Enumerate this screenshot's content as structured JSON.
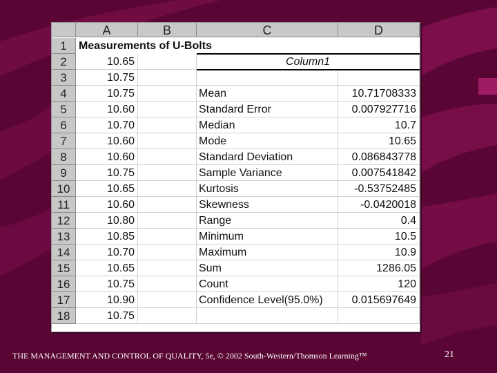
{
  "columns": [
    "A",
    "B",
    "C",
    "D"
  ],
  "title": "Measurements of U-Bolts",
  "stats_header": "Column1",
  "rows": [
    {
      "n": "1",
      "a": "",
      "c": "",
      "d": ""
    },
    {
      "n": "2",
      "a": "10.65",
      "c": "",
      "d": ""
    },
    {
      "n": "3",
      "a": "10.75",
      "c": "",
      "d": ""
    },
    {
      "n": "4",
      "a": "10.75",
      "c": "Mean",
      "d": "10.71708333"
    },
    {
      "n": "5",
      "a": "10.60",
      "c": "Standard Error",
      "d": "0.007927716"
    },
    {
      "n": "6",
      "a": "10.70",
      "c": "Median",
      "d": "10.7"
    },
    {
      "n": "7",
      "a": "10.60",
      "c": "Mode",
      "d": "10.65"
    },
    {
      "n": "8",
      "a": "10.60",
      "c": "Standard Deviation",
      "d": "0.086843778"
    },
    {
      "n": "9",
      "a": "10.75",
      "c": "Sample Variance",
      "d": "0.007541842"
    },
    {
      "n": "10",
      "a": "10.65",
      "c": "Kurtosis",
      "d": "-0.53752485"
    },
    {
      "n": "11",
      "a": "10.60",
      "c": "Skewness",
      "d": "-0.0420018"
    },
    {
      "n": "12",
      "a": "10.80",
      "c": "Range",
      "d": "0.4"
    },
    {
      "n": "13",
      "a": "10.85",
      "c": "Minimum",
      "d": "10.5"
    },
    {
      "n": "14",
      "a": "10.70",
      "c": "Maximum",
      "d": "10.9"
    },
    {
      "n": "15",
      "a": "10.65",
      "c": "Sum",
      "d": "1286.05"
    },
    {
      "n": "16",
      "a": "10.75",
      "c": "Count",
      "d": "120"
    },
    {
      "n": "17",
      "a": "10.90",
      "c": "Confidence Level(95.0%)",
      "d": "0.015697649"
    },
    {
      "n": "18",
      "a": "10.75",
      "c": "",
      "d": ""
    }
  ],
  "footer": "THE MANAGEMENT AND CONTROL OF QUALITY, 5e, © 2002 South-Western/Thomson Learning™",
  "page_number": "21",
  "colors": {
    "background": "#5a0634",
    "stripe": "#8a1456",
    "header_gray": "#c8c8c8"
  }
}
